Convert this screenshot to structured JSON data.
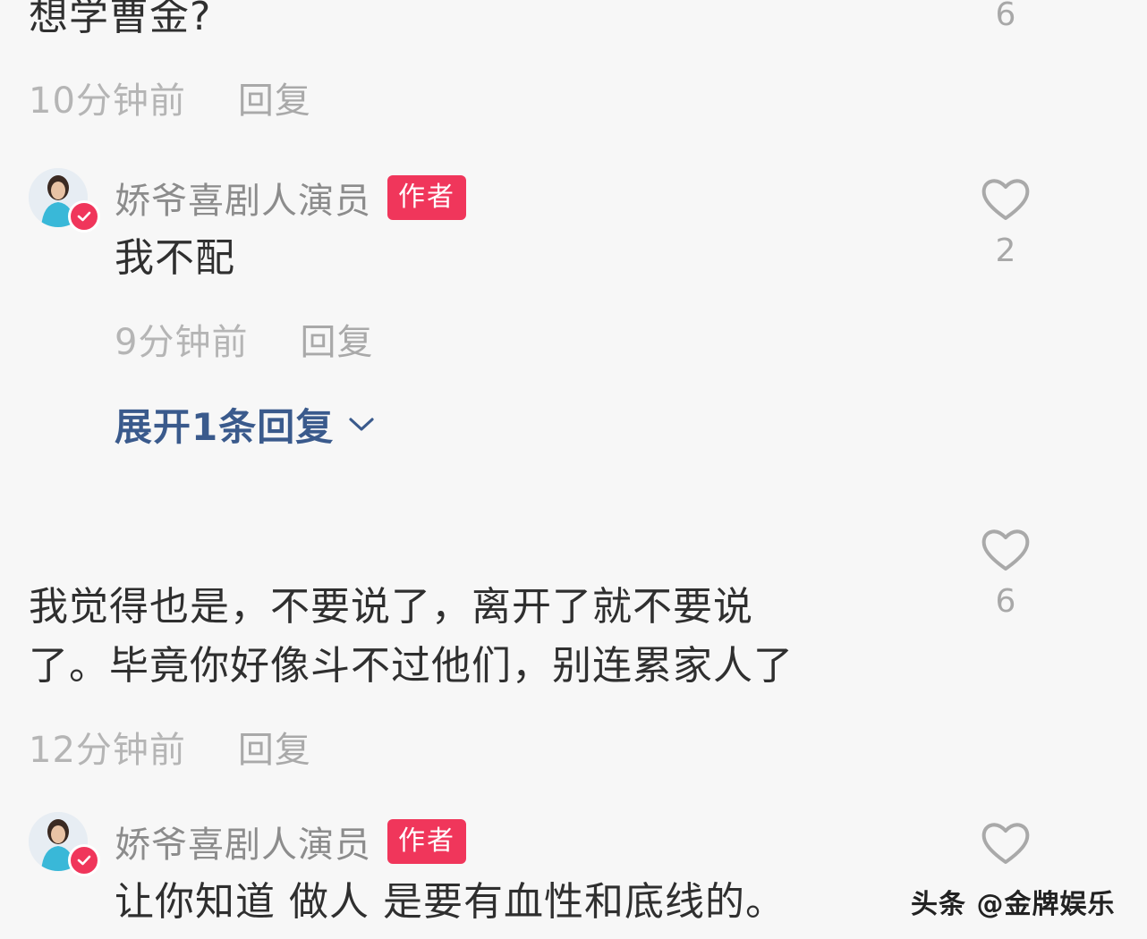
{
  "comments": [
    {
      "text": "想学曹金?",
      "time": "10分钟前",
      "reply_label": "回复",
      "likes": "6"
    },
    {
      "username": "娇爷喜剧人演员",
      "badge": "作者",
      "text": "我不配",
      "time": "9分钟前",
      "reply_label": "回复",
      "likes": "2",
      "expand_label": "展开1条回复"
    },
    {
      "text_line1": "我觉得也是，不要说了，离开了就不要说",
      "text_line2": "了。毕竟你好像斗不过他们，别连累家人了",
      "time": "12分钟前",
      "reply_label": "回复",
      "likes": "6"
    },
    {
      "username": "娇爷喜剧人演员",
      "badge": "作者",
      "text": "让你知道 做人 是要有血性和底线的。"
    }
  ],
  "watermark": "头条 @金牌娱乐",
  "icons": {
    "like": "heart-outline-icon",
    "expand": "chevron-down-icon",
    "verified": "verified-check-icon"
  },
  "colors": {
    "author_badge": "#f0365b",
    "expand_link": "#3a5a8c",
    "meta_text": "#b5b5b5"
  }
}
